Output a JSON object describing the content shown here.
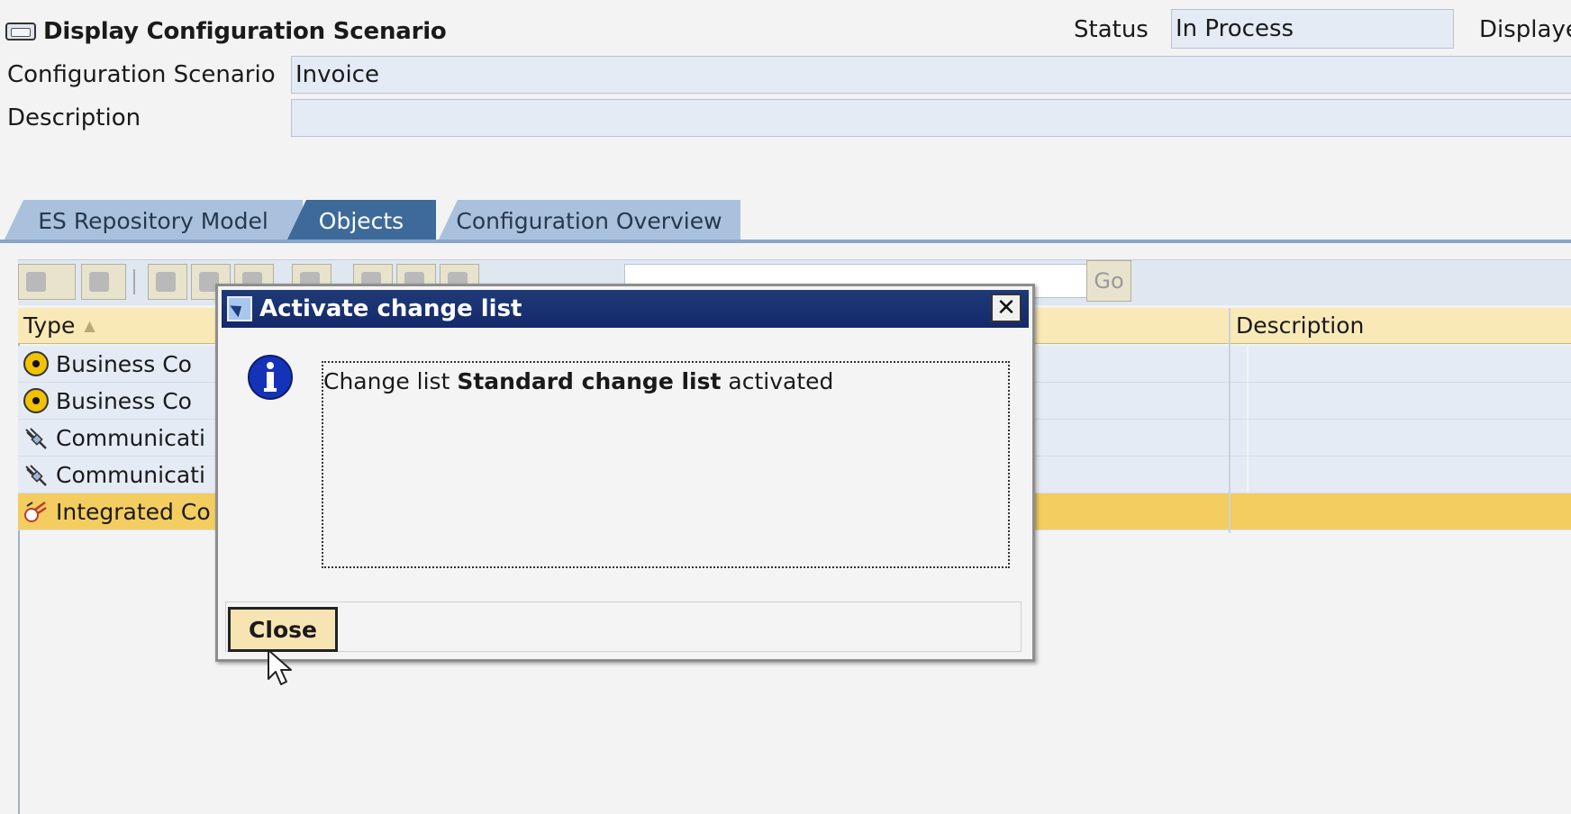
{
  "header": {
    "title": "Display Configuration Scenario",
    "status_label": "Status",
    "status_value": "In Process",
    "displayed_label": "Displaye"
  },
  "form": {
    "scenario_label": "Configuration Scenario",
    "scenario_value": "Invoice",
    "description_label": "Description",
    "description_value": ""
  },
  "tabs": [
    {
      "label": "ES Repository Model"
    },
    {
      "label": "Objects"
    },
    {
      "label": "Configuration Overview"
    }
  ],
  "toolbar": {
    "go_label": "Go"
  },
  "table": {
    "columns": [
      "Type",
      "Description"
    ],
    "rows": [
      {
        "type": "Business Co",
        "icon": "business-component-icon"
      },
      {
        "type": "Business Co",
        "icon": "business-component-icon"
      },
      {
        "type": "Communicati",
        "icon": "communication-channel-icon"
      },
      {
        "type": "Communicati",
        "icon": "communication-channel-icon"
      },
      {
        "type": "Integrated Co",
        "icon": "integrated-configuration-icon"
      }
    ]
  },
  "dialog": {
    "title": "Activate change list",
    "message_prefix": "Change list ",
    "message_bold": "Standard change list",
    "message_suffix": " activated",
    "close_button": "Close"
  },
  "colors": {
    "title_bar": "#1f3a77",
    "selected_row": "#f3cd60",
    "active_tab": "#3d6a99",
    "inactive_tab": "#a9c1dd"
  }
}
